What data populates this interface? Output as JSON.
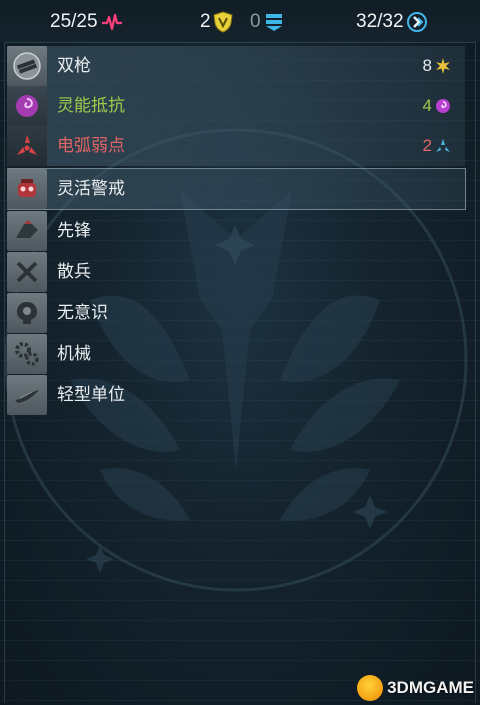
{
  "topbar": {
    "health": "25/25",
    "shield_count": "2",
    "armor_count": "0",
    "time_units": "32/32"
  },
  "traits": [
    {
      "label": "双枪",
      "value": "8",
      "icon": "dual-guns-icon",
      "value_icon": "burst-icon"
    },
    {
      "label": "灵能抵抗",
      "value": "4",
      "icon": "psionic-icon",
      "value_icon": "psionic-swirl-icon"
    },
    {
      "label": "电弧弱点",
      "value": "2",
      "icon": "arc-icon",
      "value_icon": "arc-small-icon"
    },
    {
      "label": "灵活警戒",
      "icon": "overwatch-icon"
    },
    {
      "label": "先锋",
      "icon": "vanguard-icon"
    },
    {
      "label": "散兵",
      "icon": "skirmisher-icon"
    },
    {
      "label": "无意识",
      "icon": "mindless-icon"
    },
    {
      "label": "机械",
      "icon": "mechanical-icon"
    },
    {
      "label": "轻型单位",
      "icon": "light-unit-icon"
    }
  ],
  "colors": {
    "psionic_green": "#9ec94a",
    "arc_red": "#e26464",
    "health_pink": "#ff3f7a",
    "shield_yellow": "#e8d23a",
    "armor_blue": "#3fb6e8"
  },
  "watermark": {
    "text": "3DMGAME"
  }
}
